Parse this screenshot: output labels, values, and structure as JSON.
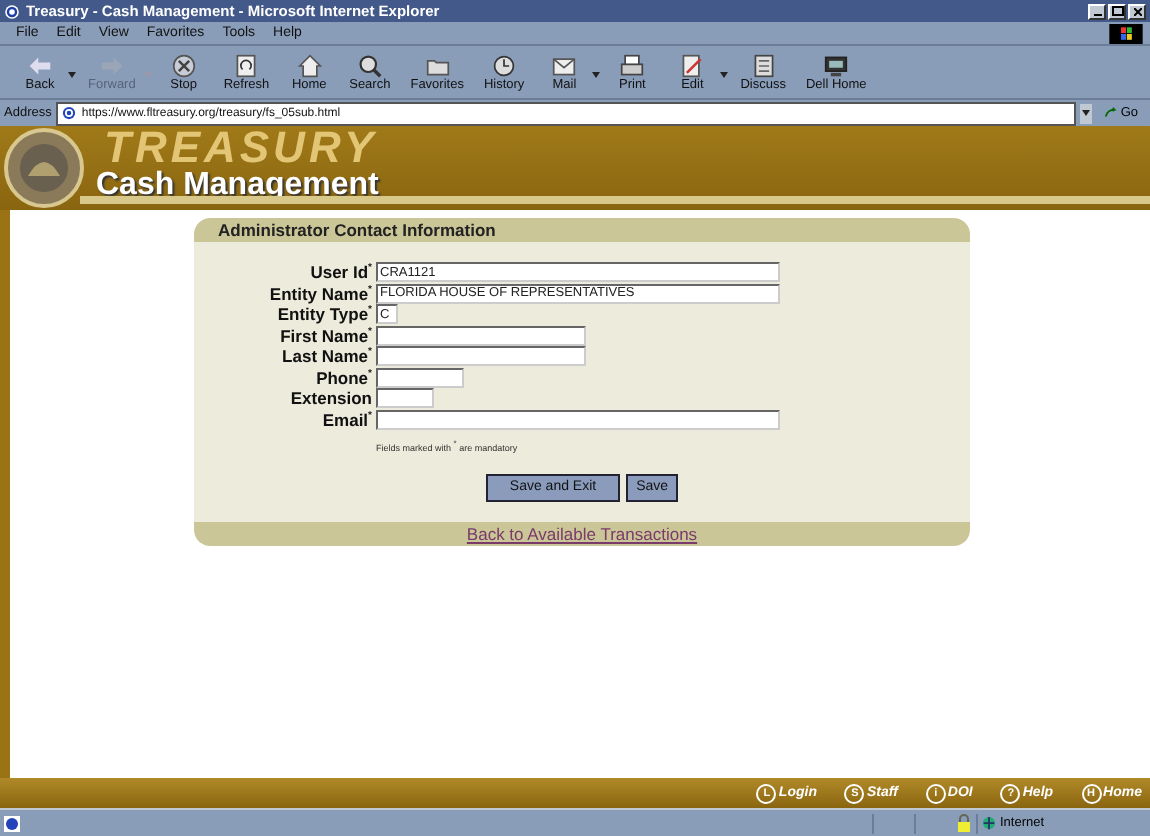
{
  "window": {
    "title": "Treasury - Cash Management - Microsoft Internet Explorer"
  },
  "menu": [
    "File",
    "Edit",
    "View",
    "Favorites",
    "Tools",
    "Help"
  ],
  "toolbar": [
    {
      "label": "Back",
      "kind": "back",
      "disabled": false,
      "dropdown": true
    },
    {
      "label": "Forward",
      "kind": "forward",
      "disabled": true,
      "dropdown": true
    },
    {
      "label": "Stop",
      "kind": "stop",
      "disabled": false,
      "dropdown": false
    },
    {
      "label": "Refresh",
      "kind": "refresh",
      "disabled": false,
      "dropdown": false
    },
    {
      "label": "Home",
      "kind": "home",
      "disabled": false,
      "dropdown": false
    },
    {
      "label": "Search",
      "kind": "search",
      "disabled": false,
      "dropdown": false
    },
    {
      "label": "Favorites",
      "kind": "favorites",
      "disabled": false,
      "dropdown": false
    },
    {
      "label": "History",
      "kind": "history",
      "disabled": false,
      "dropdown": false
    },
    {
      "label": "Mail",
      "kind": "mail",
      "disabled": false,
      "dropdown": true
    },
    {
      "label": "Print",
      "kind": "print",
      "disabled": false,
      "dropdown": false
    },
    {
      "label": "Edit",
      "kind": "edit",
      "disabled": false,
      "dropdown": true
    },
    {
      "label": "Discuss",
      "kind": "discuss",
      "disabled": false,
      "dropdown": false
    },
    {
      "label": "Dell Home",
      "kind": "dell",
      "disabled": false,
      "dropdown": false
    }
  ],
  "address": {
    "label": "Address",
    "value": "https://www.fltreasury.org/treasury/fs_05sub.html",
    "go": "Go"
  },
  "banner": {
    "watermark": "TREASURY",
    "title": "Cash Management"
  },
  "form": {
    "heading": "Administrator Contact Information",
    "fields": [
      {
        "label": "User Id$^{*}$",
        "value": "CRA1121",
        "kind": "long"
      },
      {
        "label": "Entity Name$^{*}$",
        "value": "FLORIDA HOUSE OF REPRESENTATIVES",
        "kind": "long"
      },
      {
        "label": "Entity Type$^{*}$",
        "value": "C",
        "kind": "tiny"
      },
      {
        "label": "First Name$^{*}$",
        "kind": "medium"
      },
      {
        "label": "Last Name$^{*}$",
        "kind": "medium"
      },
      {
        "label": "Phone$^{*}$",
        "kind": "short"
      },
      {
        "label": "Extension",
        "kind": "shorter"
      },
      {
        "label": "Email$^{*}$",
        "kind": "long"
      }
    ],
    "note": "Fields marked with $^{*}$ are mandatory",
    "buttons": [
      "Save and Exit",
      "Save"
    ],
    "link": "Back to Available Transactions"
  },
  "footer_links": [
    {
      "badge": "L",
      "label": "Login"
    },
    {
      "badge": "S",
      "label": "Staff"
    },
    {
      "badge": "i",
      "label": "DOI"
    },
    {
      "badge": "?",
      "label": "Help"
    },
    {
      "badge": "H",
      "label": "Home"
    }
  ],
  "status_bar": {
    "zone": "Internet"
  }
}
